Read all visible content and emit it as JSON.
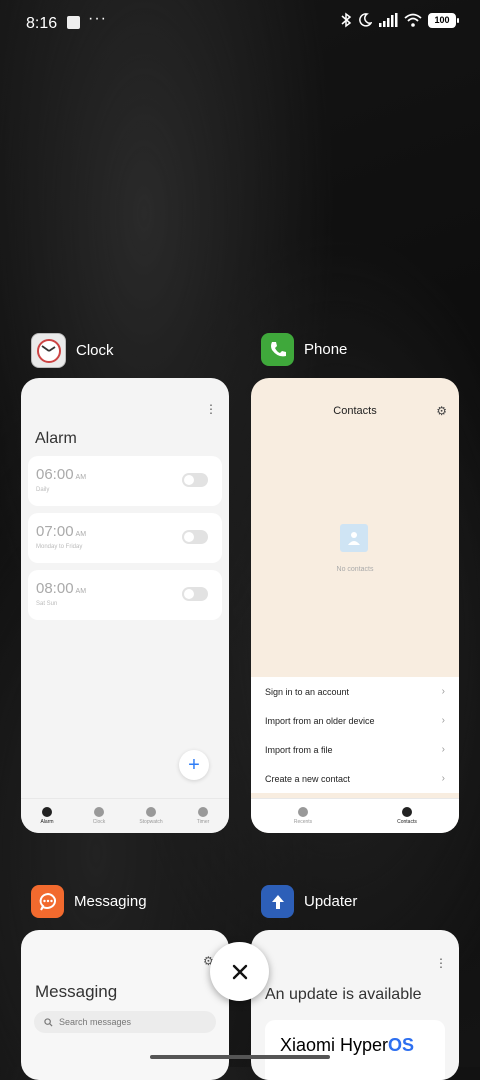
{
  "status_bar": {
    "time": "8:16",
    "dots": "···",
    "battery": "100"
  },
  "apps": [
    {
      "name": "Clock",
      "icon": "clock-app-icon",
      "color": "#e8e8e8"
    },
    {
      "name": "Phone",
      "icon": "phone-app-icon",
      "color": "#3fa83b"
    },
    {
      "name": "Messaging",
      "icon": "messaging-app-icon",
      "color": "#f26a2e"
    },
    {
      "name": "Updater",
      "icon": "updater-app-icon",
      "color": "#2d5fb8"
    }
  ],
  "clock": {
    "title": "Alarm",
    "alarms": [
      {
        "time": "06:00",
        "ampm": "AM",
        "repeat": "Daily"
      },
      {
        "time": "07:00",
        "ampm": "AM",
        "repeat": "Monday to Friday"
      },
      {
        "time": "08:00",
        "ampm": "AM",
        "repeat": "Sat Sun"
      }
    ],
    "nav": [
      "Alarm",
      "Clock",
      "Stopwatch",
      "Timer"
    ]
  },
  "phone": {
    "title": "Contacts",
    "empty_text": "No contacts",
    "menu": [
      "Sign in to an account",
      "Import from an older device",
      "Import from a file",
      "Create a new contact"
    ],
    "nav": [
      "Recents",
      "Contacts"
    ]
  },
  "messaging": {
    "title": "Messaging",
    "search_placeholder": "Search messages"
  },
  "updater": {
    "title": "An update is available",
    "brand_prefix": "Xiaomi Hyper",
    "brand_suffix": "OS"
  }
}
